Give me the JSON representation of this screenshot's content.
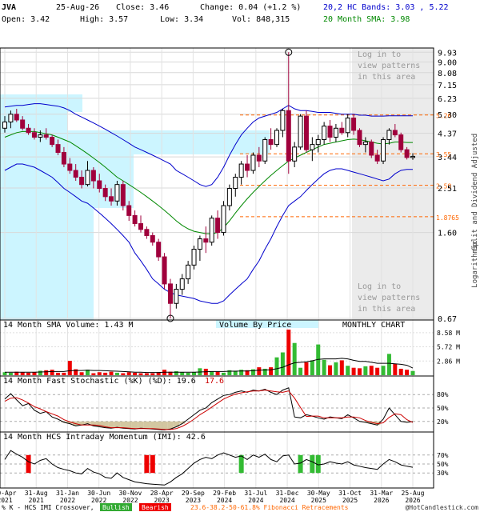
{
  "header": {
    "symbol": "JVA",
    "date": "25-Aug-26",
    "close_label": "Close: 3.46",
    "change_label": "Change: 0.04 (+1.2 %)",
    "bands_label": "20,2 HC Bands: 3.03 , 5.22",
    "open_label": "Open: 3.42",
    "high_label": "High: 3.57",
    "low_label": "Low: 3.34",
    "vol_label": "Vol: 848,315",
    "sma_label": "20 Month SMA: 3.98"
  },
  "login_note": [
    "Log in to",
    "view patterns",
    "in this area"
  ],
  "side_labels": {
    "right": "Split and Dividend Adjusted",
    "scale": "Logarithmic"
  },
  "colors": {
    "up": "#ffffff",
    "down": "#a0003c",
    "bands": "#0000cc",
    "sma": "#008800",
    "fib": "#ff6600",
    "vol_up": "#33bb33",
    "vol_down": "#ee0000",
    "stoch_k": "#000000",
    "stoch_d": "#cc0000",
    "cyan": "#ccf5ff",
    "grey": "#ebebeb",
    "accent_title": "#0000cc",
    "accent_sma": "#008800"
  },
  "chart_data": [
    {
      "type": "candlestick",
      "title": "MONTHLY CHART",
      "y_scale": "log",
      "ylim": [
        0.67,
        10.2
      ],
      "y_ticks": [
        "9.93",
        "9.00",
        "8.08",
        "7.15",
        "6.23",
        "5.30",
        "4.37",
        "3.44",
        "2.51",
        "1.60",
        "0.67"
      ],
      "fib_levels": [
        {
          "label": "5.26",
          "value": 5.26
        },
        {
          "label": "3.55",
          "value": 3.55
        },
        {
          "label": "2.58",
          "value": 2.58
        },
        {
          "label": "1.8765",
          "value": 1.8765
        }
      ],
      "x_labels": [
        "30-Apr 2021",
        "31-Aug 2021",
        "31-Jan 2022",
        "30-Jun 2022",
        "30-Nov 2022",
        "28-Apr 2023",
        "29-Sep 2023",
        "29-Feb 2024",
        "31-Jul 2024",
        "31-Dec 2024",
        "30-May 2025",
        "31-Oct 2025",
        "31-Mar 2026",
        "25-Aug 2026"
      ],
      "ohlc": [
        [
          4.6,
          5.2,
          4.4,
          4.9
        ],
        [
          4.9,
          5.5,
          4.6,
          5.3
        ],
        [
          5.3,
          5.6,
          4.9,
          5.0
        ],
        [
          5.0,
          5.2,
          4.5,
          4.6
        ],
        [
          4.6,
          4.8,
          4.3,
          4.4
        ],
        [
          4.4,
          4.6,
          4.1,
          4.2
        ],
        [
          4.2,
          4.5,
          4.0,
          4.3
        ],
        [
          4.3,
          4.6,
          4.1,
          4.2
        ],
        [
          4.2,
          4.3,
          3.8,
          3.9
        ],
        [
          3.9,
          4.1,
          3.5,
          3.6
        ],
        [
          3.6,
          3.8,
          3.1,
          3.2
        ],
        [
          3.2,
          3.4,
          2.9,
          3.0
        ],
        [
          3.0,
          3.2,
          2.7,
          2.8
        ],
        [
          2.8,
          3.0,
          2.5,
          2.6
        ],
        [
          2.6,
          3.3,
          2.55,
          3.0
        ],
        [
          3.0,
          3.1,
          2.5,
          2.7
        ],
        [
          2.7,
          2.9,
          2.4,
          2.5
        ],
        [
          2.5,
          2.6,
          2.2,
          2.3
        ],
        [
          2.3,
          2.5,
          2.1,
          2.2
        ],
        [
          2.2,
          2.7,
          2.1,
          2.6
        ],
        [
          2.6,
          2.7,
          2.0,
          2.1
        ],
        [
          2.1,
          2.2,
          1.8,
          1.9
        ],
        [
          1.9,
          2.0,
          1.7,
          1.75
        ],
        [
          1.75,
          1.9,
          1.6,
          1.65
        ],
        [
          1.65,
          1.7,
          1.5,
          1.55
        ],
        [
          1.55,
          1.6,
          1.4,
          1.45
        ],
        [
          1.45,
          1.5,
          1.2,
          1.25
        ],
        [
          1.25,
          1.3,
          0.9,
          0.95
        ],
        [
          0.95,
          1.0,
          0.67,
          0.78
        ],
        [
          0.78,
          0.95,
          0.74,
          0.9
        ],
        [
          0.9,
          1.05,
          0.85,
          1.0
        ],
        [
          1.0,
          1.2,
          0.95,
          1.15
        ],
        [
          1.15,
          1.4,
          1.1,
          1.35
        ],
        [
          1.35,
          1.55,
          1.2,
          1.5
        ],
        [
          1.5,
          1.7,
          1.3,
          1.45
        ],
        [
          1.45,
          1.9,
          1.4,
          1.85
        ],
        [
          1.85,
          2.0,
          1.5,
          1.6
        ],
        [
          1.6,
          2.2,
          1.55,
          2.1
        ],
        [
          2.1,
          2.6,
          2.0,
          2.5
        ],
        [
          2.5,
          2.9,
          2.3,
          2.8
        ],
        [
          2.8,
          3.3,
          2.6,
          3.2
        ],
        [
          3.2,
          3.5,
          2.8,
          3.0
        ],
        [
          3.0,
          3.6,
          2.9,
          3.5
        ],
        [
          3.5,
          3.8,
          3.1,
          3.3
        ],
        [
          3.3,
          4.2,
          3.2,
          4.1
        ],
        [
          4.1,
          4.6,
          3.7,
          3.9
        ],
        [
          3.9,
          4.6,
          3.8,
          4.5
        ],
        [
          4.5,
          5.6,
          4.2,
          5.5
        ],
        [
          5.5,
          9.93,
          2.9,
          3.3
        ],
        [
          3.3,
          4.0,
          3.1,
          3.8
        ],
        [
          3.8,
          5.3,
          3.7,
          5.2
        ],
        [
          5.2,
          5.5,
          3.6,
          3.7
        ],
        [
          3.7,
          4.2,
          3.3,
          3.9
        ],
        [
          3.9,
          4.3,
          3.6,
          4.1
        ],
        [
          4.1,
          4.9,
          3.9,
          4.7
        ],
        [
          4.7,
          5.0,
          4.0,
          4.2
        ],
        [
          4.2,
          4.8,
          4.0,
          4.6
        ],
        [
          4.6,
          4.9,
          4.3,
          4.4
        ],
        [
          4.4,
          5.3,
          4.2,
          5.1
        ],
        [
          5.1,
          5.3,
          4.3,
          4.5
        ],
        [
          4.5,
          4.6,
          3.8,
          3.9
        ],
        [
          3.9,
          4.2,
          3.6,
          4.0
        ],
        [
          4.0,
          4.1,
          3.4,
          3.5
        ],
        [
          3.5,
          3.7,
          3.2,
          3.3
        ],
        [
          3.3,
          4.2,
          3.2,
          4.1
        ],
        [
          4.1,
          4.6,
          3.9,
          4.5
        ],
        [
          4.5,
          4.8,
          4.2,
          4.3
        ],
        [
          4.3,
          4.4,
          3.6,
          3.7
        ],
        [
          3.7,
          3.8,
          3.35,
          3.42
        ],
        [
          3.42,
          3.57,
          3.34,
          3.46
        ]
      ],
      "bands_upper": [
        5.7,
        5.75,
        5.8,
        5.8,
        5.85,
        5.9,
        5.9,
        5.85,
        5.8,
        5.75,
        5.65,
        5.5,
        5.3,
        5.15,
        5.0,
        4.85,
        4.7,
        4.55,
        4.4,
        4.25,
        4.1,
        3.95,
        3.8,
        3.7,
        3.6,
        3.5,
        3.4,
        3.3,
        3.2,
        3.0,
        2.9,
        2.8,
        2.7,
        2.6,
        2.55,
        2.6,
        2.8,
        3.1,
        3.5,
        3.9,
        4.3,
        4.6,
        4.9,
        5.1,
        5.2,
        5.3,
        5.4,
        5.6,
        5.8,
        5.6,
        5.5,
        5.5,
        5.45,
        5.4,
        5.4,
        5.4,
        5.35,
        5.3,
        5.3,
        5.3,
        5.25,
        5.25,
        5.2,
        5.2,
        5.2,
        5.22,
        5.22,
        5.22,
        5.22,
        5.22
      ],
      "bands_lower": [
        3.0,
        3.1,
        3.2,
        3.2,
        3.15,
        3.1,
        3.0,
        2.9,
        2.8,
        2.65,
        2.5,
        2.4,
        2.3,
        2.2,
        2.15,
        2.05,
        1.95,
        1.85,
        1.75,
        1.65,
        1.55,
        1.45,
        1.3,
        1.2,
        1.1,
        1.0,
        0.95,
        0.9,
        0.87,
        0.85,
        0.84,
        0.83,
        0.82,
        0.8,
        0.79,
        0.78,
        0.78,
        0.8,
        0.85,
        0.9,
        0.95,
        1.0,
        1.1,
        1.2,
        1.35,
        1.5,
        1.7,
        1.9,
        2.1,
        2.2,
        2.3,
        2.45,
        2.6,
        2.75,
        2.9,
        3.0,
        3.05,
        3.05,
        3.0,
        2.95,
        2.9,
        2.85,
        2.8,
        2.75,
        2.7,
        2.75,
        2.9,
        3.0,
        3.03,
        3.03
      ],
      "sma": [
        4.2,
        4.3,
        4.4,
        4.45,
        4.45,
        4.45,
        4.4,
        4.35,
        4.3,
        4.2,
        4.1,
        4.0,
        3.85,
        3.7,
        3.55,
        3.4,
        3.25,
        3.1,
        2.95,
        2.8,
        2.7,
        2.6,
        2.5,
        2.4,
        2.3,
        2.2,
        2.1,
        2.0,
        1.9,
        1.8,
        1.72,
        1.66,
        1.62,
        1.6,
        1.58,
        1.58,
        1.6,
        1.68,
        1.8,
        1.95,
        2.1,
        2.25,
        2.4,
        2.55,
        2.7,
        2.85,
        3.0,
        3.15,
        3.3,
        3.4,
        3.5,
        3.6,
        3.7,
        3.8,
        3.9,
        3.95,
        4.0,
        4.05,
        4.1,
        4.12,
        4.1,
        4.05,
        4.0,
        3.95,
        3.92,
        3.95,
        4.0,
        4.0,
        3.98,
        3.98
      ]
    },
    {
      "type": "bar",
      "title": "14 Month SMA Volume: 1.43 M",
      "subtitle": "Volume By Price",
      "y_ticks": [
        "8.58 M",
        "5.72 M",
        "2.86 M"
      ],
      "ylim": [
        0,
        9.2
      ],
      "values": [
        0.6,
        0.5,
        0.7,
        0.6,
        0.5,
        0.6,
        0.9,
        1.0,
        1.1,
        0.5,
        0.5,
        2.9,
        1.2,
        0.6,
        1.1,
        0.4,
        0.6,
        0.5,
        0.7,
        0.5,
        0.4,
        0.6,
        0.5,
        0.4,
        0.4,
        0.4,
        0.6,
        1.1,
        0.7,
        0.8,
        0.6,
        0.5,
        0.6,
        1.4,
        1.3,
        0.8,
        0.7,
        0.5,
        1.0,
        0.9,
        1.1,
        1.0,
        1.2,
        1.6,
        1.3,
        1.6,
        3.6,
        4.6,
        9.2,
        6.5,
        1.5,
        2.6,
        3.0,
        6.2,
        3.1,
        2.0,
        2.6,
        3.0,
        1.9,
        1.5,
        1.4,
        1.8,
        1.9,
        1.5,
        1.9,
        4.3,
        2.3,
        1.3,
        1.1,
        0.85
      ],
      "sma": [
        0.6,
        0.6,
        0.6,
        0.6,
        0.6,
        0.6,
        0.65,
        0.7,
        0.75,
        0.75,
        0.75,
        0.9,
        0.95,
        0.95,
        1.0,
        0.95,
        0.95,
        0.9,
        0.85,
        0.8,
        0.75,
        0.7,
        0.6,
        0.6,
        0.55,
        0.55,
        0.55,
        0.6,
        0.6,
        0.6,
        0.6,
        0.6,
        0.6,
        0.65,
        0.7,
        0.75,
        0.75,
        0.75,
        0.8,
        0.8,
        0.85,
        0.85,
        0.9,
        1.0,
        1.05,
        1.1,
        1.3,
        1.6,
        2.1,
        2.5,
        2.6,
        2.7,
        2.9,
        3.2,
        3.3,
        3.3,
        3.3,
        3.4,
        3.3,
        3.0,
        2.8,
        2.8,
        2.6,
        2.4,
        2.4,
        2.4,
        2.3,
        2.2,
        2.0,
        1.43
      ]
    },
    {
      "type": "line",
      "title": "14 Month Fast Stochastic (%K) (%D): 19.6",
      "title_d_value": "17.6",
      "y_ticks": [
        "80%",
        "50%",
        "20%"
      ],
      "ylim": [
        0,
        100
      ],
      "series": [
        {
          "name": "%K",
          "values": [
            70,
            82,
            68,
            55,
            60,
            45,
            38,
            42,
            30,
            25,
            18,
            15,
            10,
            12,
            15,
            10,
            8,
            6,
            5,
            7,
            5,
            4,
            3,
            5,
            4,
            3,
            2,
            1,
            3,
            8,
            15,
            25,
            35,
            45,
            50,
            62,
            70,
            78,
            80,
            85,
            88,
            85,
            90,
            88,
            92,
            85,
            80,
            90,
            95,
            30,
            28,
            35,
            32,
            28,
            25,
            30,
            28,
            26,
            35,
            28,
            20,
            18,
            15,
            12,
            25,
            50,
            35,
            20,
            18,
            19.6
          ]
        },
        {
          "name": "%D",
          "values": [
            65,
            72,
            73,
            68,
            61,
            53,
            48,
            42,
            37,
            32,
            24,
            19,
            15,
            12,
            12,
            12,
            11,
            8,
            6,
            6,
            6,
            5,
            4,
            4,
            4,
            4,
            3,
            2,
            2,
            4,
            9,
            16,
            25,
            35,
            43,
            52,
            61,
            70,
            76,
            81,
            84,
            86,
            88,
            88,
            90,
            88,
            86,
            85,
            88,
            72,
            51,
            31,
            32,
            32,
            28,
            28,
            28,
            28,
            30,
            30,
            28,
            22,
            18,
            15,
            17,
            29,
            37,
            35,
            24,
            17.6
          ]
        }
      ]
    },
    {
      "type": "line",
      "title": "14 Month HCS Intraday Momentum (IMI): 42.6",
      "y_ticks": [
        "70%",
        "50%",
        "30%"
      ],
      "ylim": [
        0,
        100
      ],
      "values": [
        60,
        80,
        72,
        65,
        55,
        50,
        58,
        62,
        50,
        42,
        38,
        35,
        30,
        28,
        40,
        32,
        28,
        20,
        18,
        30,
        20,
        15,
        10,
        8,
        6,
        5,
        4,
        3,
        10,
        20,
        28,
        40,
        52,
        60,
        65,
        62,
        70,
        75,
        70,
        65,
        68,
        60,
        70,
        65,
        72,
        60,
        55,
        68,
        70,
        50,
        52,
        60,
        55,
        48,
        50,
        55,
        52,
        50,
        55,
        48,
        45,
        42,
        40,
        38,
        50,
        60,
        55,
        48,
        45,
        42.6
      ],
      "crossover_months": [
        4,
        24,
        25,
        40,
        50,
        52,
        53
      ]
    }
  ],
  "legend": {
    "prefix": "% K - HCS IMI Crossover,",
    "bullish": "Bullish",
    "bearish": "Bearish",
    "fib_note": "23.6-38.2-50-61.8% Fibonacci Retracements",
    "copyright": "@HotCandlestick.com"
  }
}
